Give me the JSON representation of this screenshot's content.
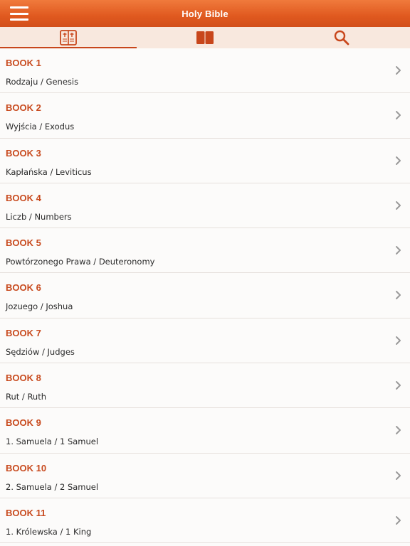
{
  "header": {
    "title": "Holy Bible"
  },
  "colors": {
    "accent": "#d8531c",
    "book_title": "#c84a1e",
    "tab_bg": "#f8e8de"
  },
  "tabs": [
    {
      "name": "tab-books",
      "icon": "bible-book-icon",
      "active": true
    },
    {
      "name": "tab-reading",
      "icon": "open-book-icon",
      "active": false
    },
    {
      "name": "tab-search",
      "icon": "search-icon",
      "active": false
    }
  ],
  "books": [
    {
      "title": "BOOK 1",
      "name": "Rodzaju / Genesis"
    },
    {
      "title": "BOOK 2",
      "name": "Wyjścia / Exodus"
    },
    {
      "title": "BOOK 3",
      "name": "Kapłańska / Leviticus"
    },
    {
      "title": "BOOK 4",
      "name": "Liczb / Numbers"
    },
    {
      "title": "BOOK 5",
      "name": "Powtórzonego Prawa / Deuteronomy"
    },
    {
      "title": "BOOK 6",
      "name": "Jozuego / Joshua"
    },
    {
      "title": "BOOK 7",
      "name": "Sędziów / Judges"
    },
    {
      "title": "BOOK 8",
      "name": "Rut / Ruth"
    },
    {
      "title": "BOOK 9",
      "name": "1. Samuela / 1 Samuel"
    },
    {
      "title": "BOOK 10",
      "name": "2. Samuela / 2 Samuel"
    },
    {
      "title": "BOOK 11",
      "name": "1. Królewska / 1 King"
    }
  ]
}
